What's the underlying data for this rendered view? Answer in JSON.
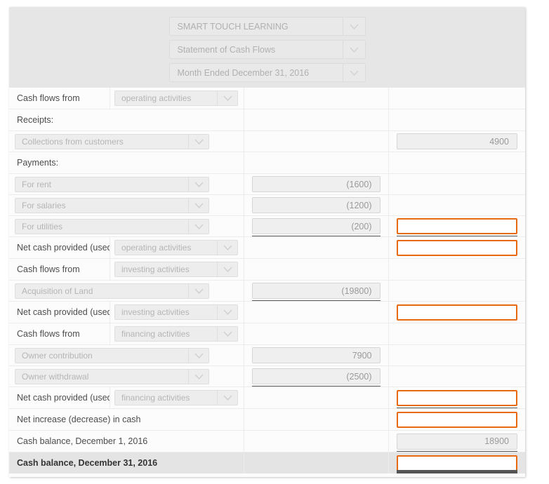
{
  "header": {
    "company": "SMART TOUCH LEARNING",
    "statement": "Statement of Cash Flows",
    "period": "Month Ended December 31, 2016"
  },
  "colors": {
    "accent_orange": "#e8690f",
    "header_bg": "#e6e6e6",
    "row_bg": "#fcfcfc",
    "total_row_bg": "#e4e4e4",
    "rule": "#595959"
  },
  "rows": [
    {
      "kind": "split",
      "label": "Cash flows from",
      "dropdown": "operating activities",
      "col1": null,
      "col2": null
    },
    {
      "kind": "text",
      "label": "Receipts:",
      "col1": null,
      "col2": null
    },
    {
      "kind": "item",
      "dropdown": "Collections from customers",
      "col1": null,
      "col2": {
        "state": "filled",
        "value": "4900"
      }
    },
    {
      "kind": "text",
      "label": "Payments:",
      "col1": null,
      "col2": null
    },
    {
      "kind": "item",
      "dropdown": "For rent",
      "col1": {
        "state": "filled",
        "value": "(1600)"
      },
      "col2": null
    },
    {
      "kind": "item",
      "dropdown": "For salaries",
      "col1": {
        "state": "filled",
        "value": "(1200)"
      },
      "col2": null
    },
    {
      "kind": "item",
      "dropdown": "For utilities",
      "col1": {
        "state": "filled",
        "value": "(200)",
        "rule": "single"
      },
      "col2": {
        "state": "blank",
        "value": "",
        "rule": "single"
      }
    },
    {
      "kind": "split",
      "label": "Net cash provided (used) by",
      "dropdown": "operating activities",
      "col1": null,
      "col2": {
        "state": "blank",
        "value": ""
      }
    },
    {
      "kind": "split",
      "label": "Cash flows from",
      "dropdown": "investing activities",
      "col1": null,
      "col2": null
    },
    {
      "kind": "item",
      "dropdown": "Acquisition of Land",
      "col1": {
        "state": "filled",
        "value": "(19800)",
        "rule": "single"
      },
      "col2": null
    },
    {
      "kind": "split",
      "label": "Net cash provided (used) by",
      "dropdown": "investing activities",
      "col1": null,
      "col2": {
        "state": "blank",
        "value": ""
      }
    },
    {
      "kind": "split",
      "label": "Cash flows from",
      "dropdown": "financing activities",
      "col1": null,
      "col2": null
    },
    {
      "kind": "item",
      "dropdown": "Owner contribution",
      "col1": {
        "state": "filled",
        "value": "7900"
      },
      "col2": null
    },
    {
      "kind": "item",
      "dropdown": "Owner withdrawal",
      "col1": {
        "state": "filled",
        "value": "(2500)",
        "rule": "single"
      },
      "col2": null
    },
    {
      "kind": "split",
      "label": "Net cash provided (used) by",
      "dropdown": "financing activities",
      "col1": null,
      "col2": {
        "state": "blank",
        "value": "",
        "rule": "single"
      }
    },
    {
      "kind": "text",
      "label": "Net increase (decrease) in cash",
      "col1": null,
      "col2": {
        "state": "blank",
        "value": ""
      }
    },
    {
      "kind": "text",
      "label": "Cash balance, December 1, 2016",
      "col1": null,
      "col2": {
        "state": "filled",
        "value": "18900",
        "rule": "single"
      }
    },
    {
      "kind": "text",
      "label": "Cash balance, December 31, 2016",
      "bold": true,
      "total": true,
      "col1": null,
      "col2": {
        "state": "blank",
        "value": "",
        "rule": "double"
      }
    }
  ]
}
